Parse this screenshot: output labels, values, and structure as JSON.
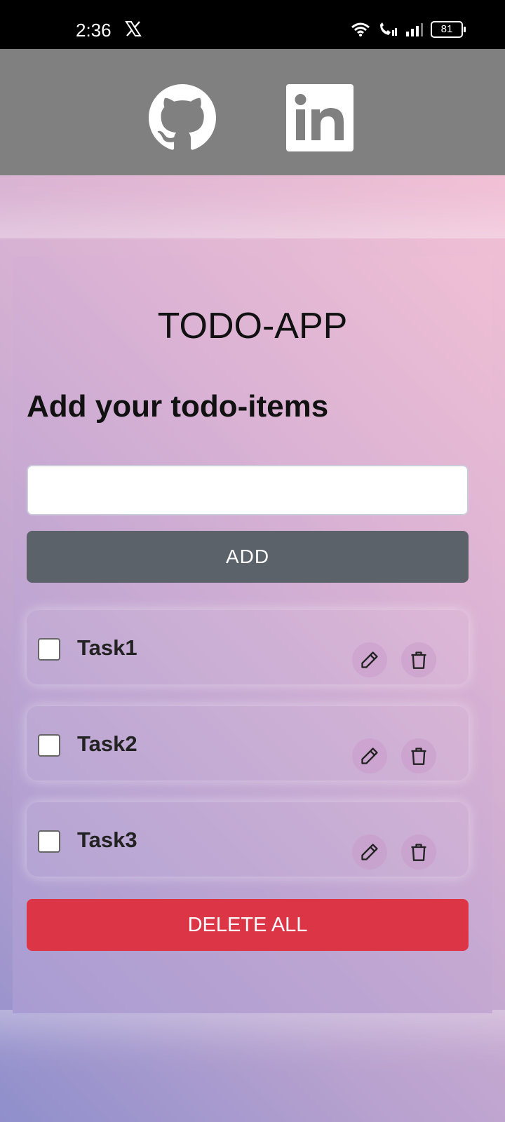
{
  "status_bar": {
    "time": "2:36",
    "battery": "81"
  },
  "social": {
    "github_icon": "github-icon",
    "linkedin_icon": "linkedin-icon"
  },
  "app": {
    "title": "TODO-APP",
    "subtitle": "Add your todo-items",
    "input": {
      "value": "",
      "placeholder": ""
    },
    "add_label": "ADD",
    "tasks": [
      {
        "label": "Task1",
        "checked": false
      },
      {
        "label": "Task2",
        "checked": false
      },
      {
        "label": "Task3",
        "checked": false
      }
    ],
    "delete_all_label": "DELETE ALL"
  },
  "colors": {
    "add_button": "#5b626a",
    "delete_all_button": "#dc3545",
    "social_bar": "#808080"
  }
}
